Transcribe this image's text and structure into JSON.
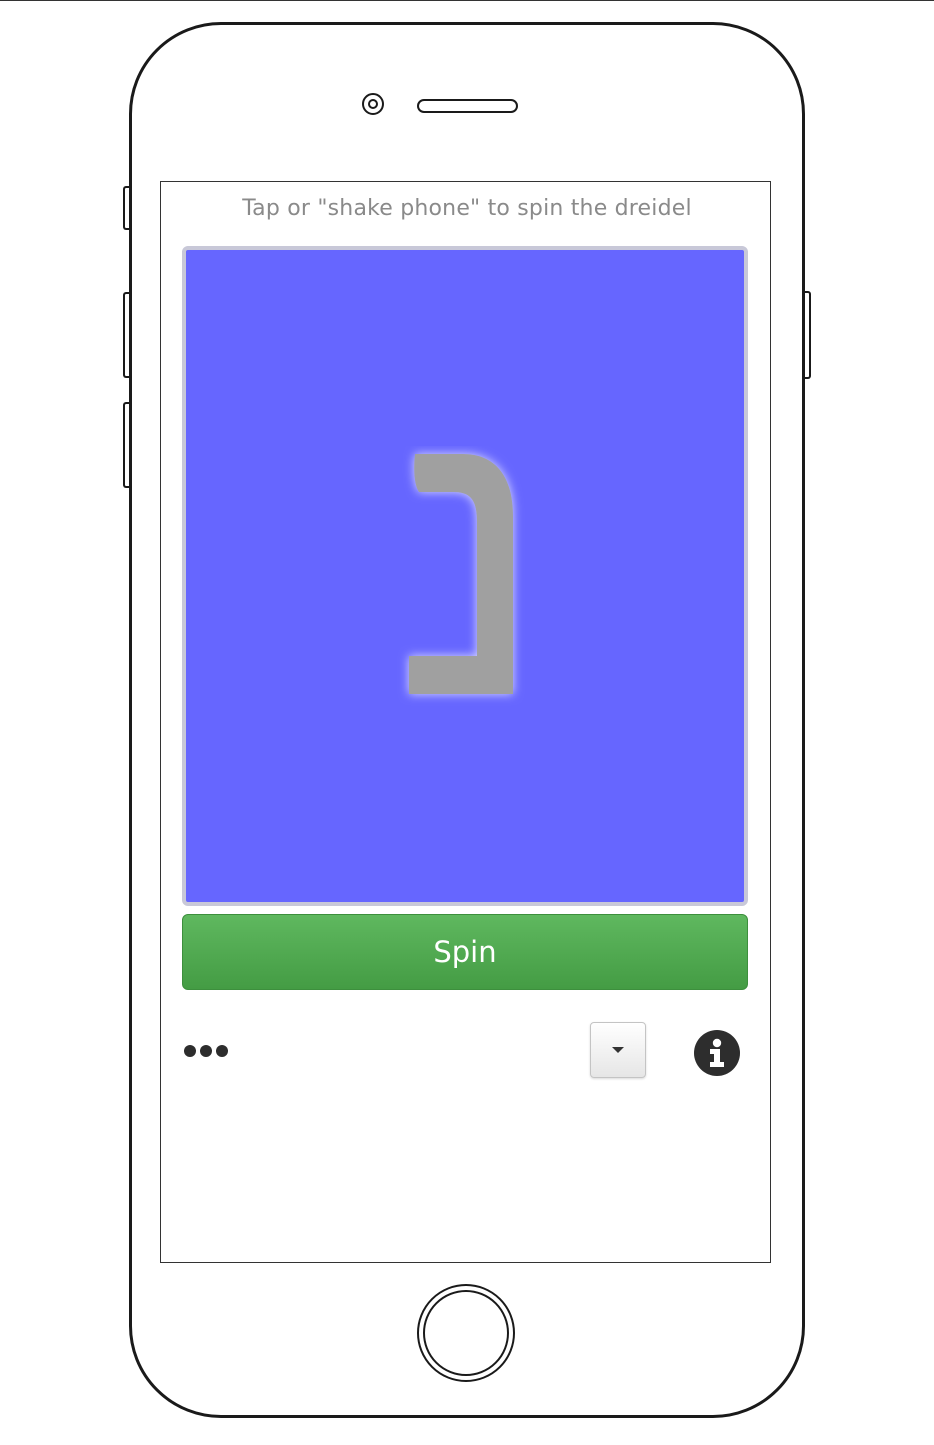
{
  "screen": {
    "instruction": "Tap or \"shake phone\" to spin the dreidel"
  },
  "dreidel": {
    "letter": "נ",
    "letter_name": "nun",
    "background_color": "#6666ff",
    "letter_color": "#a0a0a0"
  },
  "controls": {
    "spin_label": "Spin",
    "spin_color": "#4cae4c",
    "more_icon": "more-dots-icon",
    "dropdown_icon": "caret-down-icon",
    "info_icon": "info-circle-icon"
  },
  "device": {
    "home_icon": "home-button"
  }
}
